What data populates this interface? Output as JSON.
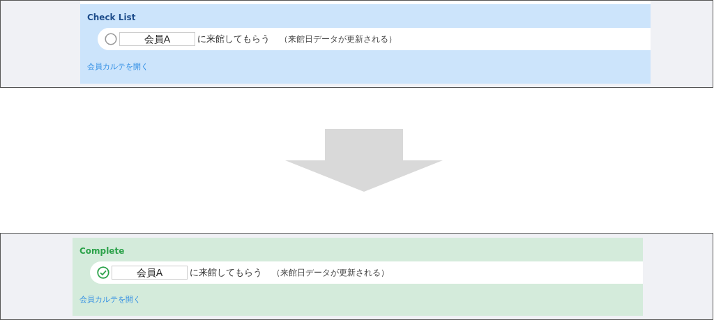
{
  "panels": [
    {
      "kind": "checklist",
      "heading": "Check List",
      "item": {
        "checked": false,
        "member": "会員A",
        "action": "に来館してもらう",
        "note": "（来館日データが更新される）"
      },
      "link": "会員カルテを開く"
    },
    {
      "kind": "complete",
      "heading": "Complete",
      "item": {
        "checked": true,
        "member": "会員A",
        "action": "に来館してもらう",
        "note": "（来館日データが更新される）"
      },
      "link": "会員カルテを開く"
    }
  ]
}
